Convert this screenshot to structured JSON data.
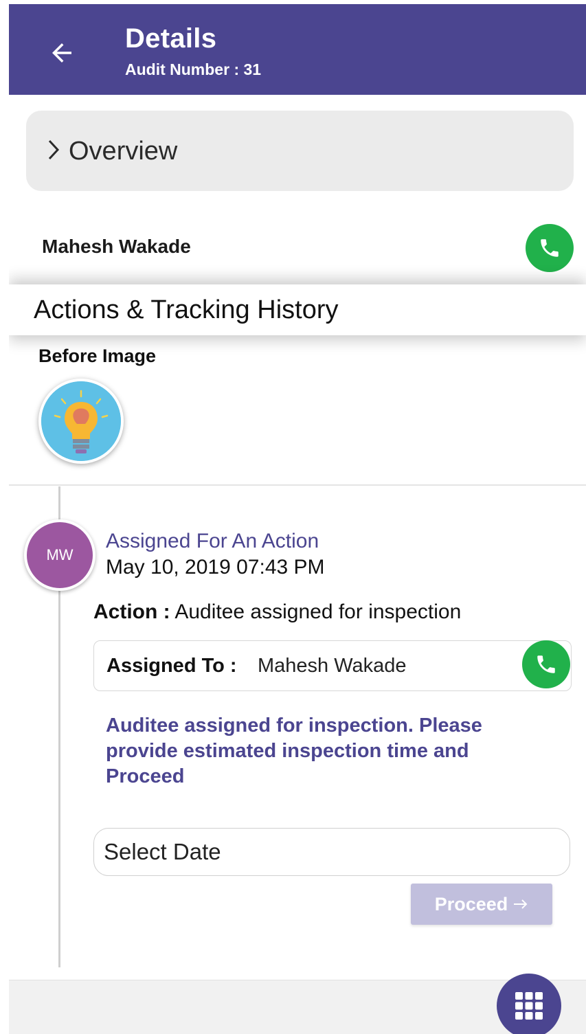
{
  "header": {
    "title": "Details",
    "subtitle": "Audit Number : 31",
    "back_icon": "arrow-left-icon",
    "color": "#4b4590"
  },
  "overview": {
    "label": "Overview",
    "icon": "chevron-right-icon"
  },
  "contact": {
    "name": "Mahesh Wakade",
    "call_icon": "phone-icon",
    "call_color": "#21b14b"
  },
  "actions_section": {
    "title": "Actions & Tracking History"
  },
  "before_image": {
    "label": "Before Image",
    "thumbnail_icon": "lightbulb-icon"
  },
  "timeline": {
    "entry": {
      "avatar_initials": "MW",
      "avatar_color": "#9c57a0",
      "title": "Assigned For An Action",
      "datetime": "May 10, 2019 07:43 PM",
      "action_label": "Action :",
      "action_value": "Auditee assigned for inspection",
      "assigned_label": "Assigned To :",
      "assigned_value": "Mahesh Wakade",
      "message": "Auditee assigned for inspection. Please provide estimated inspection time and Proceed",
      "date_placeholder": "Select Date",
      "proceed_label": "Proceed",
      "proceed_icon": "arrow-right-icon"
    }
  },
  "fab": {
    "icon": "grid-menu-icon"
  }
}
